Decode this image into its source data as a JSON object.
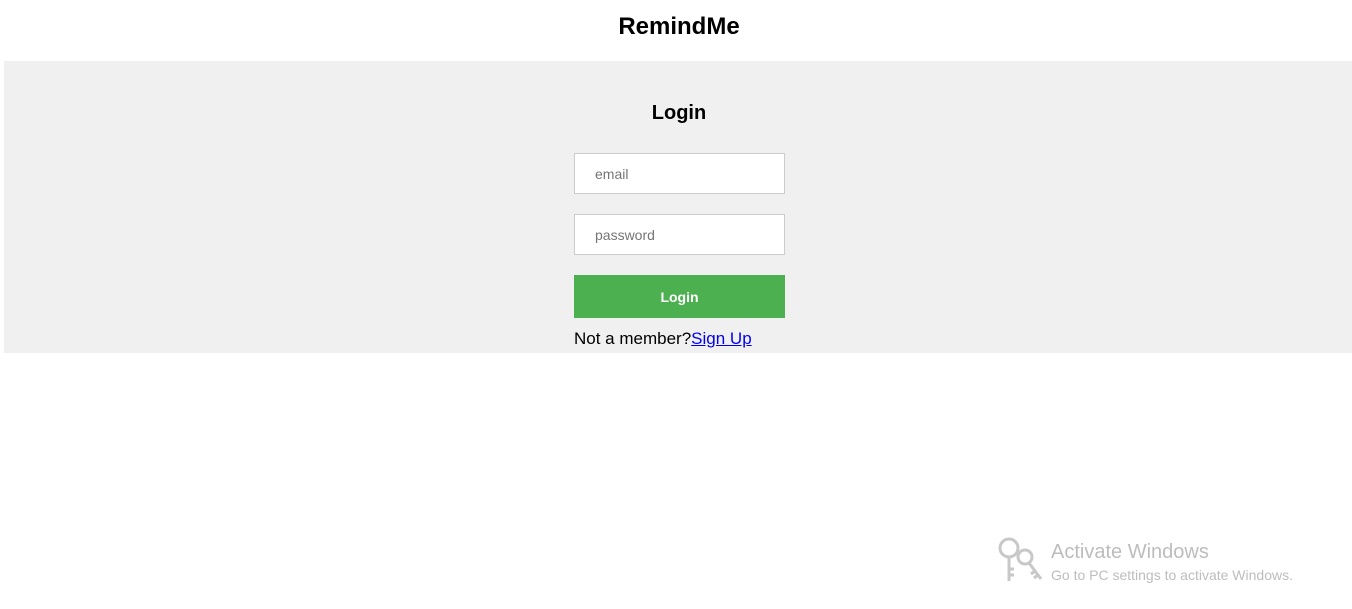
{
  "app": {
    "title": "RemindMe"
  },
  "login": {
    "heading": "Login",
    "email": {
      "value": "",
      "placeholder": "email"
    },
    "password": {
      "value": "",
      "placeholder": "password"
    },
    "button_label": "Login",
    "signup_prompt": "Not a member?",
    "signup_link": "Sign Up"
  },
  "watermark": {
    "icon": "keys-icon",
    "title": "Activate Windows",
    "subtitle": "Go to PC settings to activate Windows."
  },
  "colors": {
    "panel_background": "#f0f0f0",
    "button_accent": "#4caf50",
    "link": "#0000ee",
    "watermark_text": "#bdbdbd"
  }
}
